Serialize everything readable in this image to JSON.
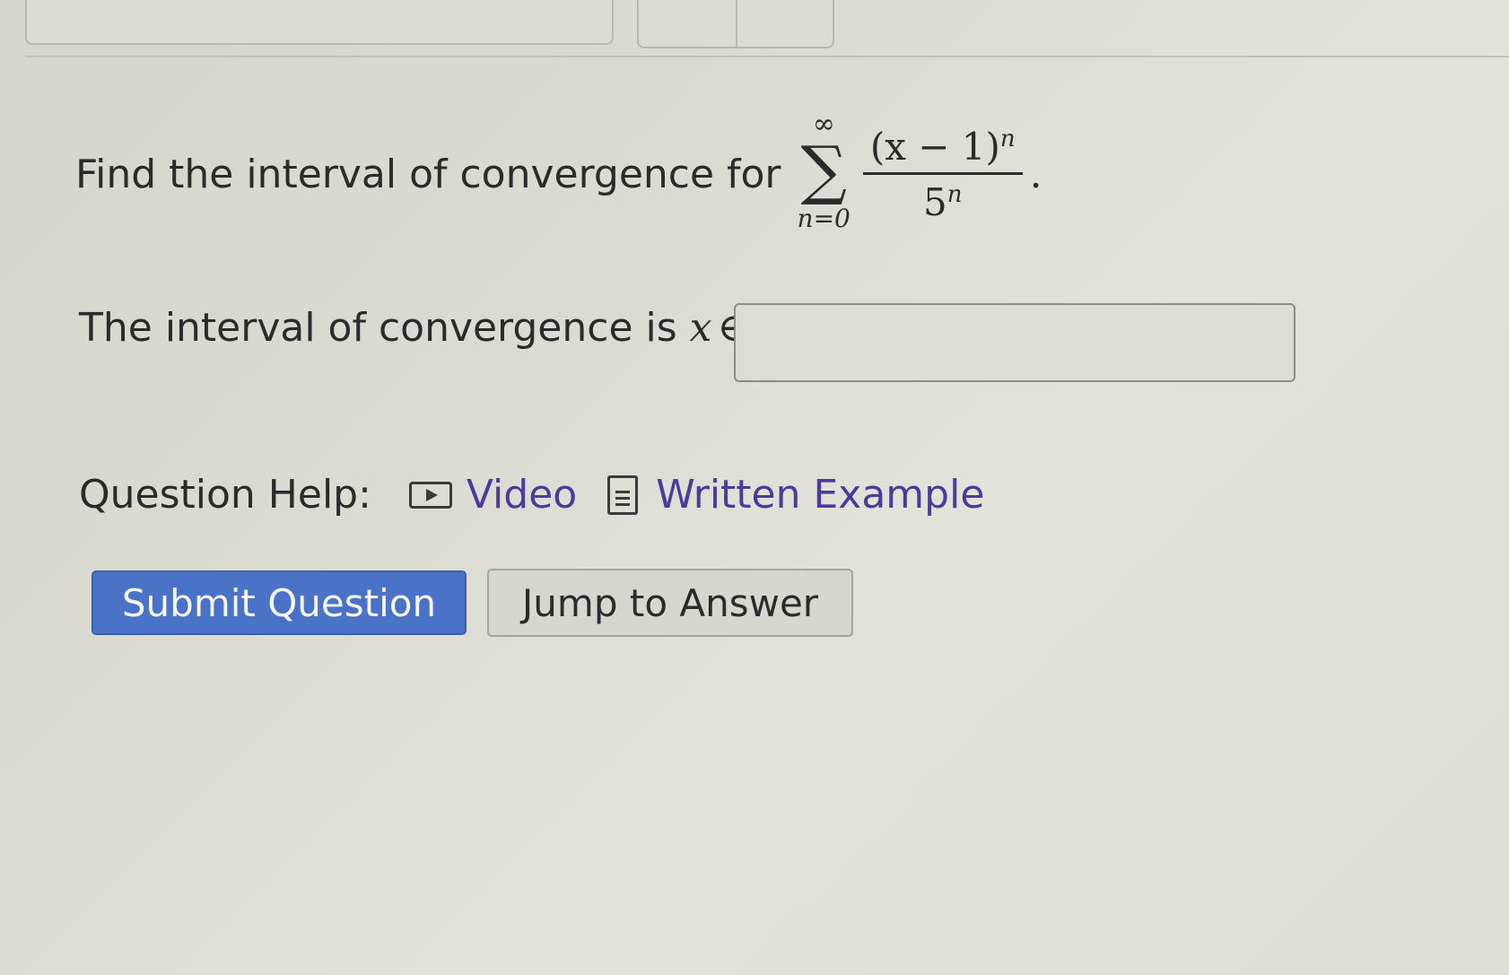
{
  "question": {
    "prompt": "Find the interval of convergence for",
    "sum_upper": "∞",
    "sum_symbol": "∑",
    "sum_lower": "n=0",
    "numerator_base": "(x − 1)",
    "numerator_exp": "n",
    "denominator_base": "5",
    "denominator_exp": "n",
    "period": "."
  },
  "answer": {
    "label": "The interval of convergence is",
    "variable": "x",
    "element_of": "∈",
    "value": "",
    "placeholder": ""
  },
  "help": {
    "label": "Question Help:",
    "video_label": "Video",
    "written_label": "Written Example",
    "link_color": "#4d3b9c"
  },
  "buttons": {
    "submit_label": "Submit Question",
    "jump_label": "Jump to Answer",
    "submit_color": "#4a72c6"
  }
}
